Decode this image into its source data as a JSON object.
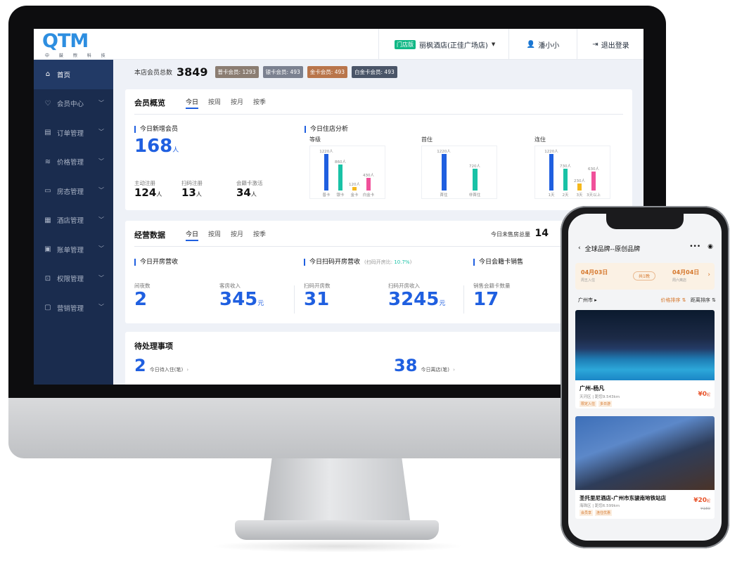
{
  "app": {
    "logo_text": "QTM",
    "logo_sub": "中 鼓 煦 科 技",
    "store_tag": "门店版",
    "store_name": "丽枫酒店(正佳广场店)",
    "username": "潘小小",
    "logout_label": "退出登录"
  },
  "sidebar": {
    "items": [
      {
        "label": "首页",
        "icon": "home-icon"
      },
      {
        "label": "会员中心",
        "icon": "member-icon"
      },
      {
        "label": "订单管理",
        "icon": "order-icon"
      },
      {
        "label": "价格管理",
        "icon": "price-icon"
      },
      {
        "label": "房态管理",
        "icon": "room-icon"
      },
      {
        "label": "酒店管理",
        "icon": "hotel-icon"
      },
      {
        "label": "账单管理",
        "icon": "bill-icon"
      },
      {
        "label": "权限管理",
        "icon": "lock-icon"
      },
      {
        "label": "营销管理",
        "icon": "marketing-icon"
      }
    ]
  },
  "summary": {
    "label": "本店会员总数",
    "total": "3849",
    "badges": [
      {
        "label": "普卡会员: 1293",
        "color": "#8b7d72"
      },
      {
        "label": "银卡会员: 493",
        "color": "#7b8190"
      },
      {
        "label": "金卡会员: 493",
        "color": "#b9754b"
      },
      {
        "label": "白金卡会员: 493",
        "color": "#4a5568"
      }
    ]
  },
  "overview": {
    "title": "会员概览",
    "tabs": [
      "今日",
      "按周",
      "按月",
      "按季"
    ],
    "new_title": "今日新增会员",
    "new_value": "168",
    "new_unit": "人",
    "stats": [
      {
        "label": "主动注册",
        "value": "124",
        "unit": "人"
      },
      {
        "label": "扫码注册",
        "value": "13",
        "unit": "人"
      },
      {
        "label": "会籍卡激活",
        "value": "34",
        "unit": "人"
      }
    ],
    "analysis_title": "今日住店分析"
  },
  "chart_data": [
    {
      "type": "bar",
      "title": "等级",
      "categories": [
        "普卡",
        "银卡",
        "金卡",
        "白金卡"
      ],
      "values": [
        1220,
        860,
        120,
        430
      ],
      "value_labels": [
        "1220人",
        "860人",
        "120人",
        "430人"
      ],
      "colors": [
        "#1f5fe0",
        "#19c2a6",
        "#f5b81c",
        "#f0509a"
      ],
      "ylim": [
        0,
        1220
      ]
    },
    {
      "type": "bar",
      "title": "首住",
      "categories": [
        "首住",
        "非首住"
      ],
      "values": [
        1220,
        720
      ],
      "value_labels": [
        "1220人",
        "720人"
      ],
      "colors": [
        "#1f5fe0",
        "#19c2a6"
      ],
      "ylim": [
        0,
        1220
      ]
    },
    {
      "type": "bar",
      "title": "连住",
      "categories": [
        "1天",
        "2天",
        "3天",
        "3天以上"
      ],
      "values": [
        1220,
        730,
        230,
        630
      ],
      "value_labels": [
        "1220人",
        "730人",
        "230人",
        "630人"
      ],
      "colors": [
        "#1f5fe0",
        "#19c2a6",
        "#f5b81c",
        "#f0509a"
      ],
      "ylim": [
        0,
        1220
      ]
    }
  ],
  "operations": {
    "title": "经营数据",
    "tabs": [
      "今日",
      "按周",
      "按月",
      "按季"
    ],
    "unsold_label": "今日未售房总量",
    "unsold_value": "14",
    "sections": [
      {
        "title": "今日开房营收",
        "items": [
          {
            "label": "间夜数",
            "value": "2",
            "unit": ""
          },
          {
            "label": "客房收入",
            "value": "345",
            "unit": "元"
          }
        ]
      },
      {
        "title": "今日扫码开房营收",
        "note_prefix": "(扫码开房比: ",
        "note_value": "10.7%",
        "note_suffix": ")",
        "items": [
          {
            "label": "扫码开房数",
            "value": "31",
            "unit": ""
          },
          {
            "label": "扫码开房收入",
            "value": "3245",
            "unit": "元"
          }
        ]
      },
      {
        "title": "今日会籍卡销售",
        "items": [
          {
            "label": "销售会籍卡数量",
            "value": "17",
            "unit": ""
          }
        ]
      }
    ]
  },
  "todo": {
    "title": "待处理事项",
    "checkin_value": "2",
    "checkin_label": "今日待入住(笔)",
    "checkout_value": "38",
    "checkout_label": "今日离店(笔)"
  },
  "phone": {
    "title": "全球品牌--原创品牌",
    "checkin_date": "04月03日",
    "checkin_sub": "周五入住",
    "nights": "共1晚",
    "checkout_date": "04月04日",
    "checkout_sub": "周六离店",
    "city": "广州市",
    "sort_price": "价格排序",
    "sort_distance": "距离排序",
    "hotels": [
      {
        "name": "广州-杨凡",
        "addr": "天河区 | 距您9.543km",
        "tags": [
          "限定入住",
          "多日游"
        ],
        "price": "¥0",
        "price_unit": "起",
        "old_price": ""
      },
      {
        "name": "圣托里尼酒店-广州市东骏南地铁站店",
        "addr": "海珠区 | 距您6.599km",
        "tags": [
          "会员享",
          "连住优惠"
        ],
        "price": "¥20",
        "price_unit": "起",
        "old_price": "¥180"
      }
    ]
  }
}
